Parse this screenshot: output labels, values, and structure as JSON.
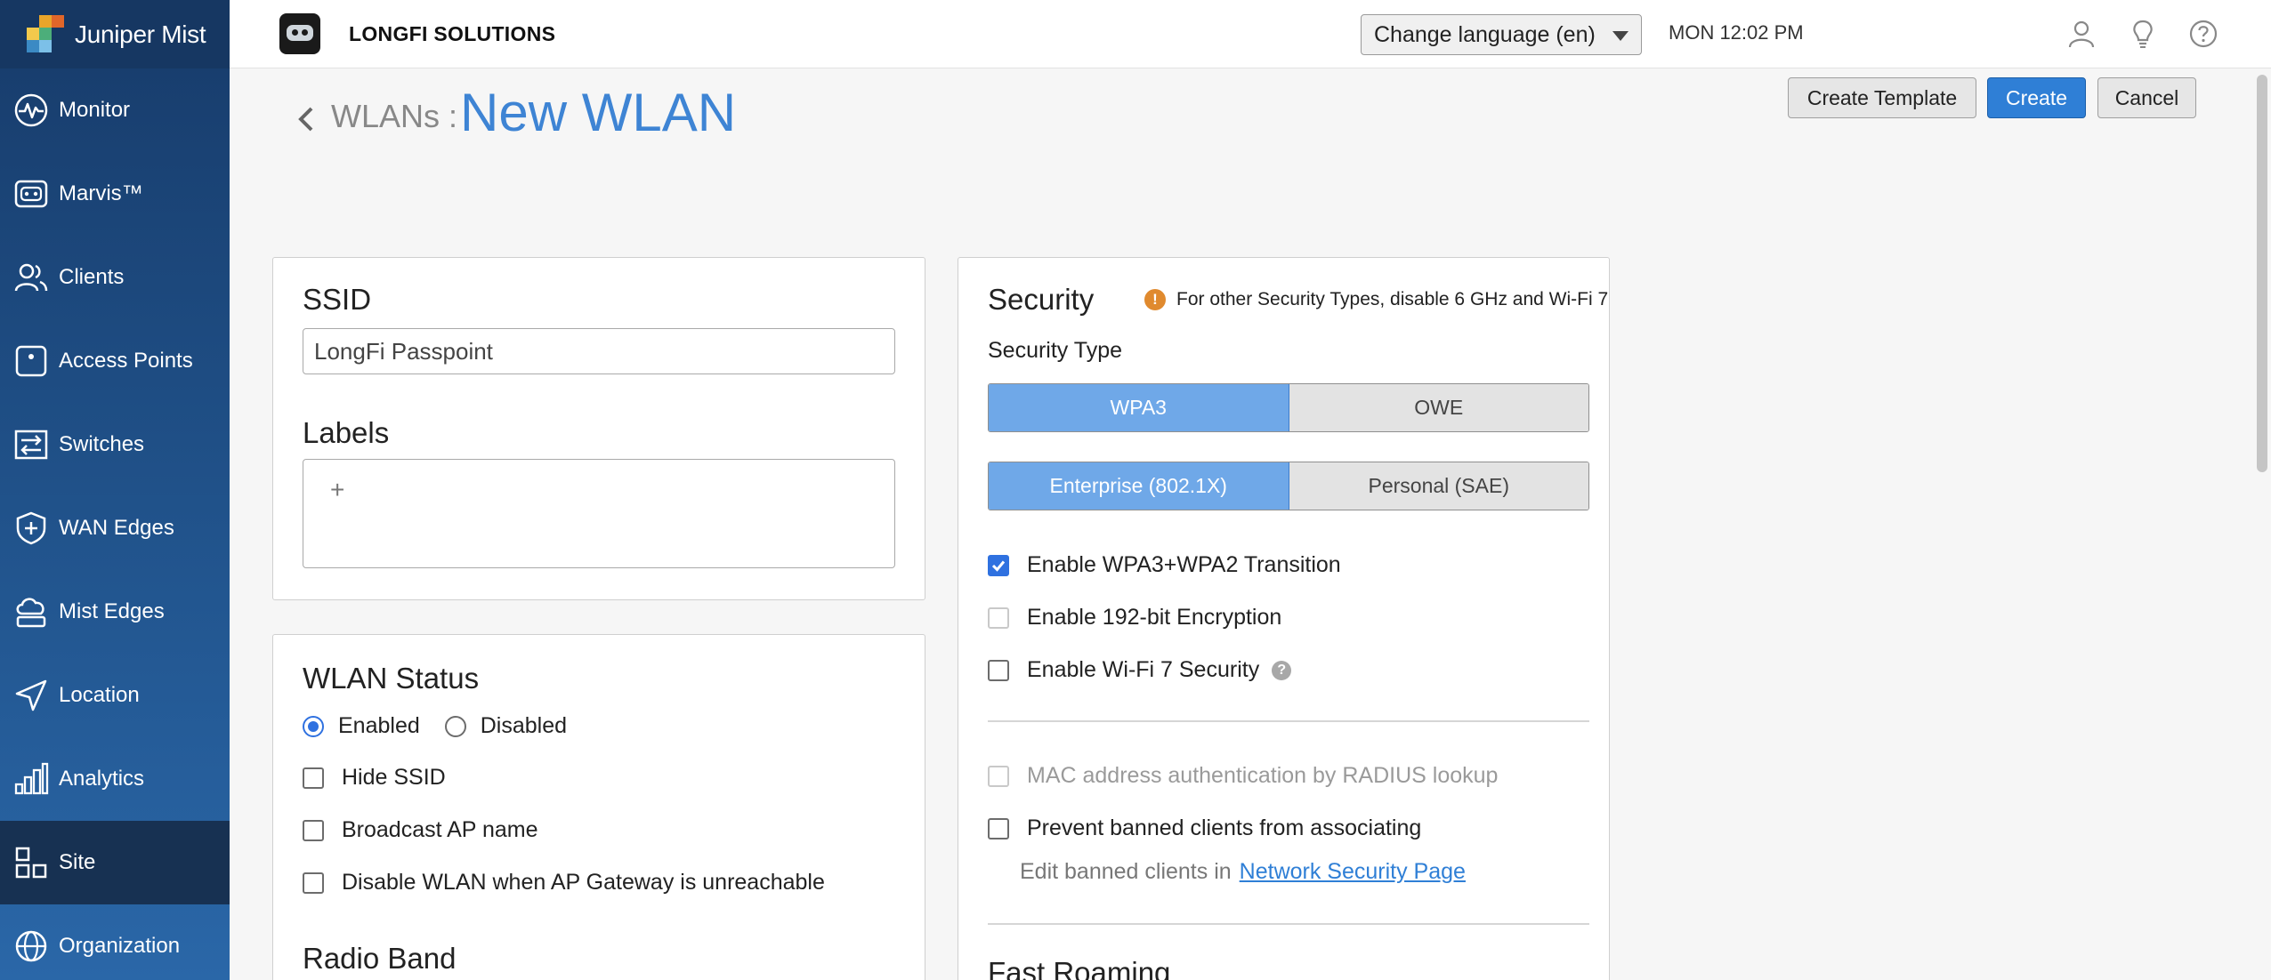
{
  "app": {
    "brand": "Juniper Mist",
    "org_name": "LONGFI SOLUTIONS"
  },
  "sidebar": {
    "items": [
      {
        "label": "Monitor",
        "icon": "monitor-pulse-icon"
      },
      {
        "label": "Marvis™",
        "icon": "marvis-icon"
      },
      {
        "label": "Clients",
        "icon": "clients-icon"
      },
      {
        "label": "Access Points",
        "icon": "access-point-icon"
      },
      {
        "label": "Switches",
        "icon": "switches-icon"
      },
      {
        "label": "WAN Edges",
        "icon": "wan-edge-shield-icon"
      },
      {
        "label": "Mist Edges",
        "icon": "cloud-icon"
      },
      {
        "label": "Location",
        "icon": "location-arrow-icon"
      },
      {
        "label": "Analytics",
        "icon": "analytics-bars-icon"
      },
      {
        "label": "Site",
        "icon": "site-icon"
      },
      {
        "label": "Organization",
        "icon": "globe-icon"
      }
    ],
    "active": "Site"
  },
  "header": {
    "language_select": "Change language (en)",
    "clock": "MON 12:02 PM",
    "icons": [
      "user-icon",
      "lightbulb-icon",
      "help-icon"
    ]
  },
  "page": {
    "breadcrumb": "WLANs :",
    "title": "New WLAN",
    "buttons": {
      "create_template": "Create Template",
      "create": "Create",
      "cancel": "Cancel"
    }
  },
  "ssid_panel": {
    "ssid_label": "SSID",
    "ssid_value": "LongFi Passpoint",
    "labels_label": "Labels",
    "labels_add": "+"
  },
  "status_panel": {
    "title": "WLAN Status",
    "radio_enabled": "Enabled",
    "radio_disabled": "Disabled",
    "selected": "Enabled",
    "hide_ssid": "Hide SSID",
    "broadcast_ap_name": "Broadcast AP name",
    "disable_when_gateway": "Disable WLAN when AP Gateway is unreachable",
    "radio_band_title": "Radio Band"
  },
  "security_panel": {
    "title": "Security",
    "notice": "For other Security Types, disable 6 GHz and Wi-Fi 7",
    "security_type_label": "Security Type",
    "type_options": [
      "WPA3",
      "OWE"
    ],
    "type_selected": "WPA3",
    "mode_options": [
      "Enterprise (802.1X)",
      "Personal (SAE)"
    ],
    "mode_selected": "Enterprise (802.1X)",
    "enable_transition": "Enable WPA3+WPA2 Transition",
    "enable_192": "Enable 192-bit Encryption",
    "enable_wifi7": "Enable Wi-Fi 7 Security",
    "mac_auth": "MAC address authentication by RADIUS lookup",
    "prevent_banned": "Prevent banned clients from associating",
    "edit_banned_prefix": "Edit banned clients in",
    "edit_banned_link": "Network Security Page",
    "fast_roaming_title": "Fast Roaming"
  },
  "colors": {
    "accent": "#3e84d4",
    "primary_button": "#2f7fd6",
    "sidebar": "#1f4f86",
    "notice": "#e08a2e"
  }
}
